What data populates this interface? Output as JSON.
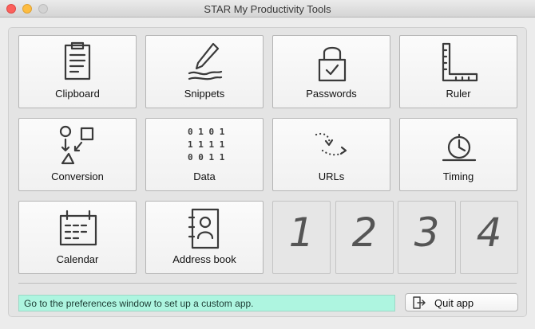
{
  "window": {
    "title": "STAR My Productivity Tools"
  },
  "tools": [
    {
      "label": "Clipboard",
      "icon": "clipboard-icon"
    },
    {
      "label": "Snippets",
      "icon": "pen-icon"
    },
    {
      "label": "Passwords",
      "icon": "padlock-icon"
    },
    {
      "label": "Ruler",
      "icon": "ruler-icon"
    },
    {
      "label": "Conversion",
      "icon": "shapes-conversion-icon"
    },
    {
      "label": "Data",
      "icon": "binary-data-icon"
    },
    {
      "label": "URLs",
      "icon": "dotted-arrow-icon"
    },
    {
      "label": "Timing",
      "icon": "stopwatch-icon"
    },
    {
      "label": "Calendar",
      "icon": "calendar-icon"
    },
    {
      "label": "Address book",
      "icon": "address-card-icon"
    }
  ],
  "custom_slots": [
    "1",
    "2",
    "3",
    "4"
  ],
  "status": {
    "text": "Go to the preferences window to set up a custom app."
  },
  "quit": {
    "label": "Quit app",
    "icon": "exit-door-icon"
  },
  "colors": {
    "status_bg": "#aef5e0",
    "close": "#fc605c",
    "minimize": "#fdbc40"
  }
}
